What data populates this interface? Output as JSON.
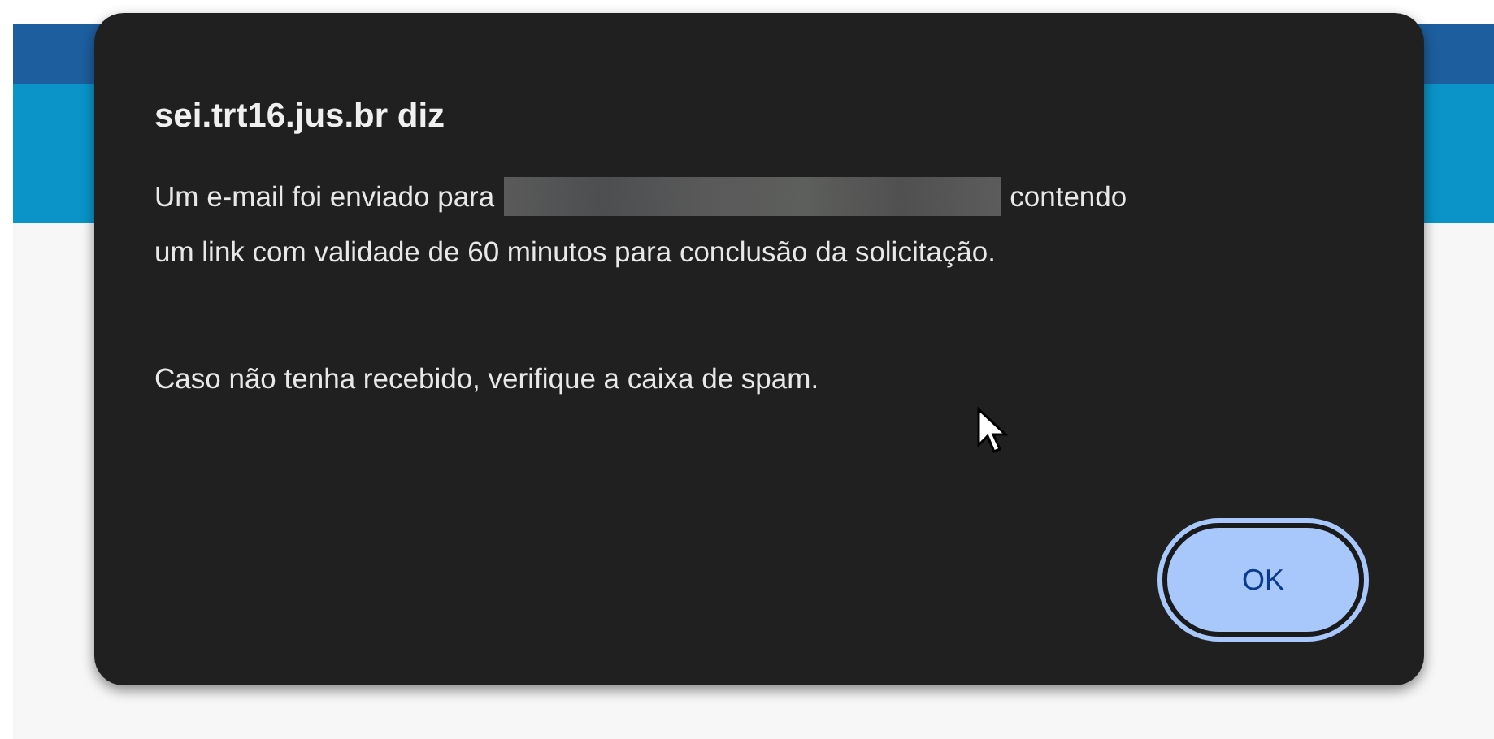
{
  "dialog": {
    "title": "sei.trt16.jus.br diz",
    "message_line_1_start": "Um e-mail foi enviado para",
    "message_line_1_end": "contendo",
    "message_line_2": "um link com validade de 60 minutos para conclusão da solicitação.",
    "message_line_3": "Caso não tenha recebido, verifique a caixa de spam.",
    "buttons": [
      {
        "label": "OK",
        "focused": true
      }
    ]
  }
}
